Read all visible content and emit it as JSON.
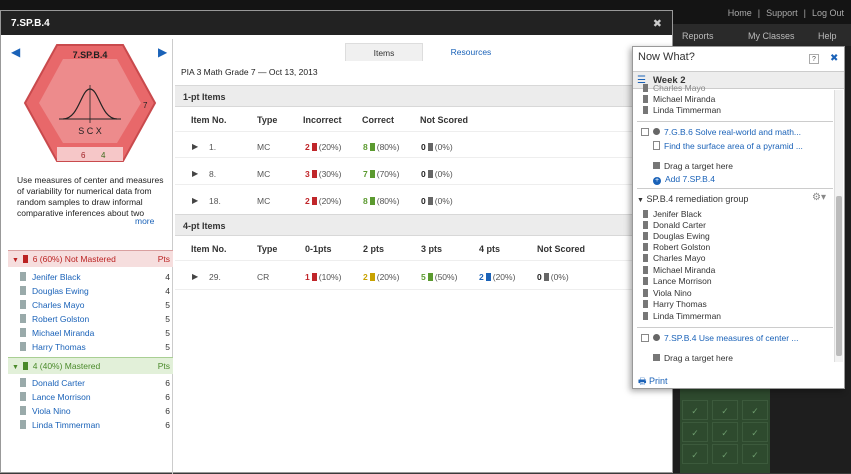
{
  "background": {
    "top_links": [
      "Home",
      "|",
      "Support",
      "|",
      "Log Out"
    ],
    "tabs": [
      "Reports",
      "My Classes",
      "Help"
    ]
  },
  "modal": {
    "title": "7.SP.B.4",
    "standard_badge": {
      "code": "7.SP.B.4",
      "glyph_text": "S C X",
      "count_right": "7",
      "count_bottom_left": "6",
      "count_bottom_right": "4",
      "color": "#e8686a"
    },
    "description": "Use measures of center and measures of variability for numerical data from random samples to draw informal comparative inferences about two",
    "more_label": "more",
    "groups": [
      {
        "label": "6 (60%)  Not Mastered",
        "pts_label": "Pts",
        "students": [
          {
            "name": "Jenifer Black",
            "pts": "4"
          },
          {
            "name": "Douglas Ewing",
            "pts": "4"
          },
          {
            "name": "Charles Mayo",
            "pts": "5"
          },
          {
            "name": "Robert Golston",
            "pts": "5"
          },
          {
            "name": "Michael Miranda",
            "pts": "5"
          },
          {
            "name": "Harry Thomas",
            "pts": "5"
          }
        ]
      },
      {
        "label": "4 (40%)  Mastered",
        "pts_label": "Pts",
        "students": [
          {
            "name": "Donald Carter",
            "pts": "6"
          },
          {
            "name": "Lance Morrison",
            "pts": "6"
          },
          {
            "name": "Viola Nino",
            "pts": "6"
          },
          {
            "name": "Linda Timmerman",
            "pts": "6"
          }
        ]
      }
    ],
    "tabs": {
      "items": "Items",
      "resources": "Resources"
    },
    "assessment_title": "PIA 3 Math Grade 7 — Oct 13, 2013",
    "one_pt": {
      "header": "1-pt Items",
      "columns": [
        "Item No.",
        "Type",
        "Incorrect",
        "Correct",
        "Not Scored"
      ],
      "rows": [
        {
          "item": "1.",
          "type": "MC",
          "incorrect": "2",
          "incorrect_pct": "(20%)",
          "correct": "8",
          "correct_pct": "(80%)",
          "not_scored": "0",
          "not_scored_pct": "(0%)"
        },
        {
          "item": "8.",
          "type": "MC",
          "incorrect": "3",
          "incorrect_pct": "(30%)",
          "correct": "7",
          "correct_pct": "(70%)",
          "not_scored": "0",
          "not_scored_pct": "(0%)"
        },
        {
          "item": "18.",
          "type": "MC",
          "incorrect": "2",
          "incorrect_pct": "(20%)",
          "correct": "8",
          "correct_pct": "(80%)",
          "not_scored": "0",
          "not_scored_pct": "(0%)"
        }
      ]
    },
    "four_pt": {
      "header": "4-pt Items",
      "columns": [
        "Item No.",
        "Type",
        "0-1pts",
        "2 pts",
        "3 pts",
        "4 pts",
        "Not Scored"
      ],
      "rows": [
        {
          "item": "29.",
          "type": "CR",
          "c01": "1",
          "c01_pct": "(10%)",
          "c2": "2",
          "c2_pct": "(20%)",
          "c3": "5",
          "c3_pct": "(50%)",
          "c4": "2",
          "c4_pct": "(20%)",
          "ns": "0",
          "ns_pct": "(0%)"
        }
      ]
    }
  },
  "now_what": {
    "title": "Now What?",
    "help": "?",
    "close": "✖",
    "week": "Week 2",
    "top_students": [
      "Charles Mayo",
      "Michael Miranda",
      "Linda Timmerman"
    ],
    "target1_title": "7.G.B.6 Solve real-world and math...",
    "target1_resource": "Find the surface area of a pyramid ...",
    "drag_target": "Drag a target here",
    "add_label": "Add 7.SP.B.4",
    "group_title": "SP.B.4 remediation group",
    "group_students": [
      "Jenifer Black",
      "Donald Carter",
      "Douglas Ewing",
      "Robert Golston",
      "Charles Mayo",
      "Michael Miranda",
      "Lance Morrison",
      "Viola Nino",
      "Harry Thomas",
      "Linda Timmerman"
    ],
    "target2_title": "7.SP.B.4 Use measures of center ...",
    "drag_target2": "Drag a target here",
    "print": "Print"
  }
}
